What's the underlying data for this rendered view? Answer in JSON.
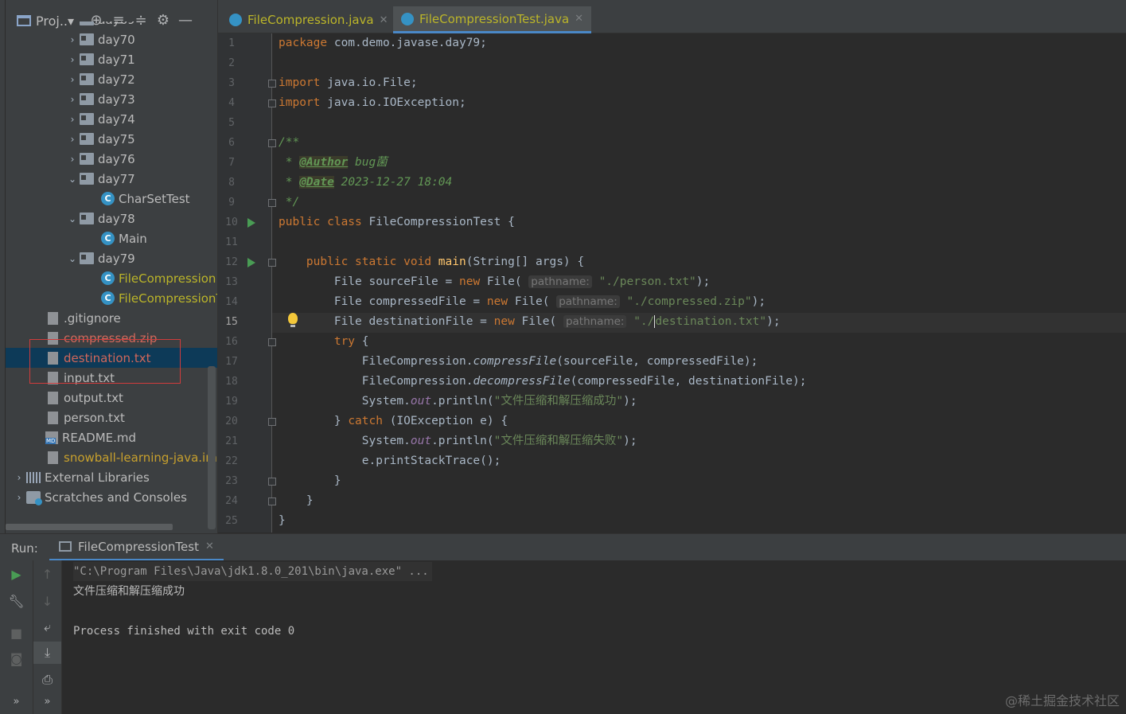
{
  "project_panel": {
    "title": "Proj..▾",
    "tree": [
      {
        "label": "day69",
        "kind": "folder",
        "arrow": "›",
        "status": "ok"
      },
      {
        "label": "day70",
        "kind": "folder",
        "arrow": "›",
        "status": "ok"
      },
      {
        "label": "day71",
        "kind": "folder",
        "arrow": "›",
        "status": "ok"
      },
      {
        "label": "day72",
        "kind": "folder",
        "arrow": "›",
        "status": "ok"
      },
      {
        "label": "day73",
        "kind": "folder",
        "arrow": "›",
        "status": "ok"
      },
      {
        "label": "day74",
        "kind": "folder",
        "arrow": "›",
        "status": "ok"
      },
      {
        "label": "day75",
        "kind": "folder",
        "arrow": "›",
        "status": "ok"
      },
      {
        "label": "day76",
        "kind": "folder",
        "arrow": "›",
        "status": "ok"
      },
      {
        "label": "day77",
        "kind": "folder",
        "arrow": "⌄",
        "status": "ok"
      },
      {
        "label": "CharSetTest",
        "kind": "class",
        "status": "ok"
      },
      {
        "label": "day78",
        "kind": "folder",
        "arrow": "⌄",
        "status": "ok"
      },
      {
        "label": "Main",
        "kind": "class",
        "status": "ok"
      },
      {
        "label": "day79",
        "kind": "folder",
        "arrow": "⌄",
        "status": "ok"
      },
      {
        "label": "FileCompression",
        "kind": "class",
        "status": "changed"
      },
      {
        "label": "FileCompressionT",
        "kind": "class",
        "status": "changed"
      },
      {
        "label": ".gitignore",
        "kind": "file",
        "status": "ok"
      },
      {
        "label": "compressed.zip",
        "kind": "file",
        "status": "unversioned"
      },
      {
        "label": "destination.txt",
        "kind": "file",
        "status": "unversioned"
      },
      {
        "label": "input.txt",
        "kind": "file",
        "status": "ok"
      },
      {
        "label": "output.txt",
        "kind": "file",
        "status": "ok"
      },
      {
        "label": "person.txt",
        "kind": "file",
        "status": "ok"
      },
      {
        "label": "README.md",
        "kind": "md",
        "status": "ok"
      },
      {
        "label": "snowball-learning-java.iml",
        "kind": "file",
        "status": "ignored"
      },
      {
        "label": "External Libraries",
        "kind": "lib",
        "arrow": "›",
        "status": "ok"
      },
      {
        "label": "Scratches and Consoles",
        "kind": "scratch",
        "arrow": "›",
        "status": "ok"
      }
    ]
  },
  "editor_tabs": [
    {
      "label": "FileCompression.java",
      "active": false
    },
    {
      "label": "FileCompressionTest.java",
      "active": true
    }
  ],
  "editor": {
    "current_line": 15,
    "lines": [
      "<span class=\"kw\">package</span> com.demo.javase.day79;",
      "",
      "<span class=\"kw\">import</span> java.io.File;",
      "<span class=\"kw\">import</span> java.io.IOException;",
      "",
      "<span class=\"cmt\">/**</span>",
      "<span class=\"cmt\"> * </span><span class=\"tag\">@Author</span><span class=\"cmt\"> bug菌</span>",
      "<span class=\"cmt\"> * </span><span class=\"tag\">@Date</span><span class=\"cmt\"> 2023-12-27 18:04</span>",
      "<span class=\"cmt\"> */</span>",
      "<span class=\"kw\">public class</span> FileCompressionTest {",
      "",
      "    <span class=\"kw\">public static void</span> <span class=\"method\">main</span>(String[] args) {",
      "        File sourceFile = <span class=\"kw\">new</span> File( <span class=\"hint\">pathname:</span> <span class=\"str\">\"./person.txt\"</span>);",
      "        File compressedFile = <span class=\"kw\">new</span> File( <span class=\"hint\">pathname:</span> <span class=\"str\">\"./compressed.zip\"</span>);",
      "        File destinationFile = <span class=\"kw\">new</span> File( <span class=\"hint\">pathname:</span> <span class=\"str\">\"./<span class=\"caret\"></span>destination.txt\"</span>);",
      "        <span class=\"kw\">try</span> {",
      "            FileCompression.<span class=\"static-m\">compressFile</span>(sourceFile, compressedFile);",
      "            FileCompression.<span class=\"static-m\">decompressFile</span>(compressedFile, destinationFile);",
      "            System.<span class=\"field\">out</span>.println(<span class=\"str\">\"文件压缩和解压缩成功\"</span>);",
      "        } <span class=\"kw\">catch</span> (IOException e) {",
      "            System.<span class=\"field\">out</span>.println(<span class=\"str\">\"文件压缩和解压缩失败\"</span>);",
      "            e.printStackTrace();",
      "        }",
      "    }",
      "}"
    ],
    "run_markers": [
      10,
      12
    ],
    "fold_markers": [
      3,
      4,
      6,
      9,
      12,
      16,
      20,
      23,
      24
    ]
  },
  "run_panel": {
    "label": "Run:",
    "tab_label": "FileCompressionTest",
    "console": [
      {
        "text": "\"C:\\Program Files\\Java\\jdk1.8.0_201\\bin\\java.exe\" ...",
        "type": "cmd"
      },
      {
        "text": "文件压缩和解压缩成功",
        "type": "out"
      },
      {
        "text": "",
        "type": "out"
      },
      {
        "text": "Process finished with exit code 0",
        "type": "out"
      }
    ]
  },
  "watermark": "@稀土掘金技术社区"
}
